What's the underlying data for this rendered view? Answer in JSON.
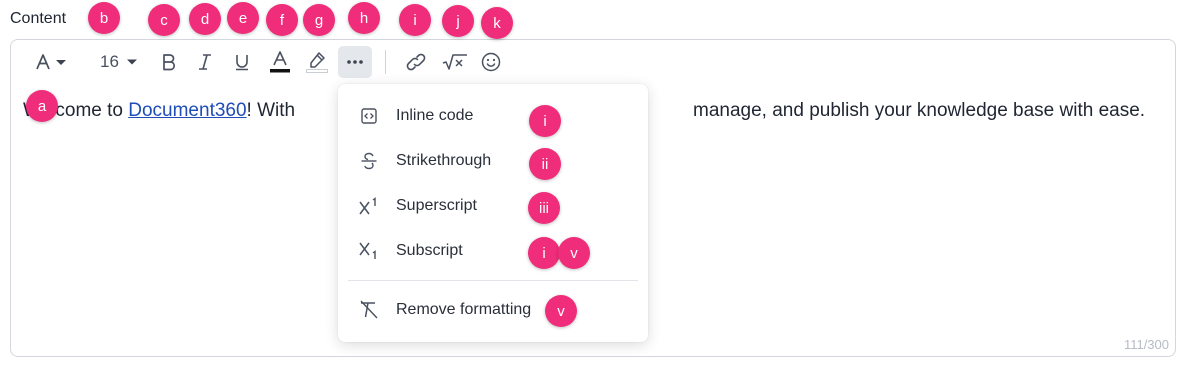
{
  "field_label": "Content",
  "toolbar": {
    "font_size": "16"
  },
  "editor": {
    "text_before_link": "Welcome to ",
    "link_text": "Document360",
    "text_after_link": "!  With",
    "text_tail": "manage, and publish your knowledge base with ease.",
    "char_counter": "111/300"
  },
  "more_menu": {
    "items": [
      {
        "label": "Inline code",
        "icon": "code-icon"
      },
      {
        "label": "Strikethrough",
        "icon": "strikethrough-icon"
      },
      {
        "label": "Superscript",
        "icon": "superscript-icon"
      },
      {
        "label": "Subscript",
        "icon": "subscript-icon"
      },
      {
        "label": "Remove formatting",
        "icon": "remove-formatting-icon"
      }
    ]
  },
  "callouts": {
    "a": "a",
    "b": "b",
    "c": "c",
    "d": "d",
    "e": "e",
    "f": "f",
    "g": "g",
    "h": "h",
    "i": "i",
    "j": "j",
    "k": "k",
    "menu_1": "i",
    "menu_2": "ii",
    "menu_3": "iii",
    "menu_4a": "i",
    "menu_4b": "v",
    "menu_5": "v"
  },
  "colors": {
    "badge": "#ef2d7a",
    "link": "#1e4db7",
    "font_color_bar": "#111111"
  }
}
